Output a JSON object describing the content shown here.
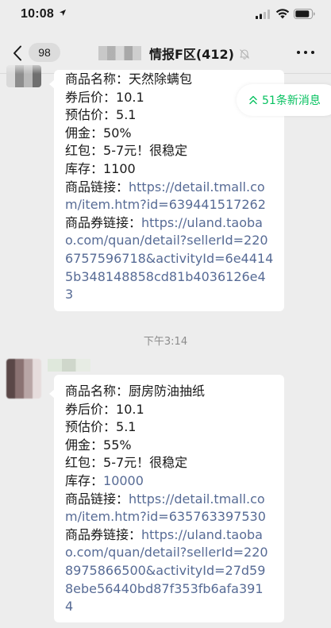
{
  "status_bar": {
    "time": "10:08"
  },
  "nav": {
    "unread_count": "98",
    "chat_title": "情报F区(412)"
  },
  "new_messages": {
    "label": "51条新消息"
  },
  "timestamp": "下午3:14",
  "messages": [
    {
      "lines": [
        {
          "label": "商品名称：",
          "text": "天然除螨包"
        },
        {
          "label": "券后价：",
          "text": "10.1"
        },
        {
          "label": "预估价：",
          "text": "5.1"
        },
        {
          "label": "佣金：",
          "text": "50%"
        },
        {
          "label": "红包：",
          "text": "5-7元！很稳定"
        },
        {
          "label": "库存：",
          "text": "1100"
        },
        {
          "label": "商品链接：",
          "link": "https://detail.tmall.co"
        },
        {
          "link": "m/item.htm?id=639441517262"
        },
        {
          "label": "商品券链接：",
          "link": "https://uland.taoba"
        },
        {
          "link": "o.com/quan/detail?sellerId=220"
        },
        {
          "link": "6757596718&activityId=6e4414"
        },
        {
          "link": "5b348148858cd81b4036126e4"
        },
        {
          "link": "3"
        }
      ]
    },
    {
      "lines": [
        {
          "label": "商品名称：",
          "text": "厨房防油抽纸"
        },
        {
          "label": "券后价：",
          "text": "10.1"
        },
        {
          "label": "预估价：",
          "text": "5.1"
        },
        {
          "label": "佣金：",
          "text": "55%"
        },
        {
          "label": "红包：",
          "text": "5-7元！很稳定"
        },
        {
          "label": "库存：",
          "link": "10000"
        },
        {
          "label": "商品链接：",
          "link": "https://detail.tmall.co"
        },
        {
          "link": "m/item.htm?id=635763397530"
        },
        {
          "label": "商品券链接：",
          "link": "https://uland.taoba"
        },
        {
          "link": "o.com/quan/detail?sellerId=220"
        },
        {
          "link": "8975866500&activityId=27d59"
        },
        {
          "link": "8ebe56440bd87f353fb6afa391"
        },
        {
          "link": "4"
        }
      ]
    }
  ],
  "colors": {
    "background": "#ededed",
    "bubble": "#ffffff",
    "link": "#576b95",
    "accent_green": "#07c160"
  },
  "icons": [
    "location-arrow-icon",
    "signal-icon",
    "wifi-icon",
    "battery-icon",
    "chevron-left-icon",
    "mute-bell-icon",
    "more-dots-icon",
    "double-chevron-up-icon"
  ]
}
